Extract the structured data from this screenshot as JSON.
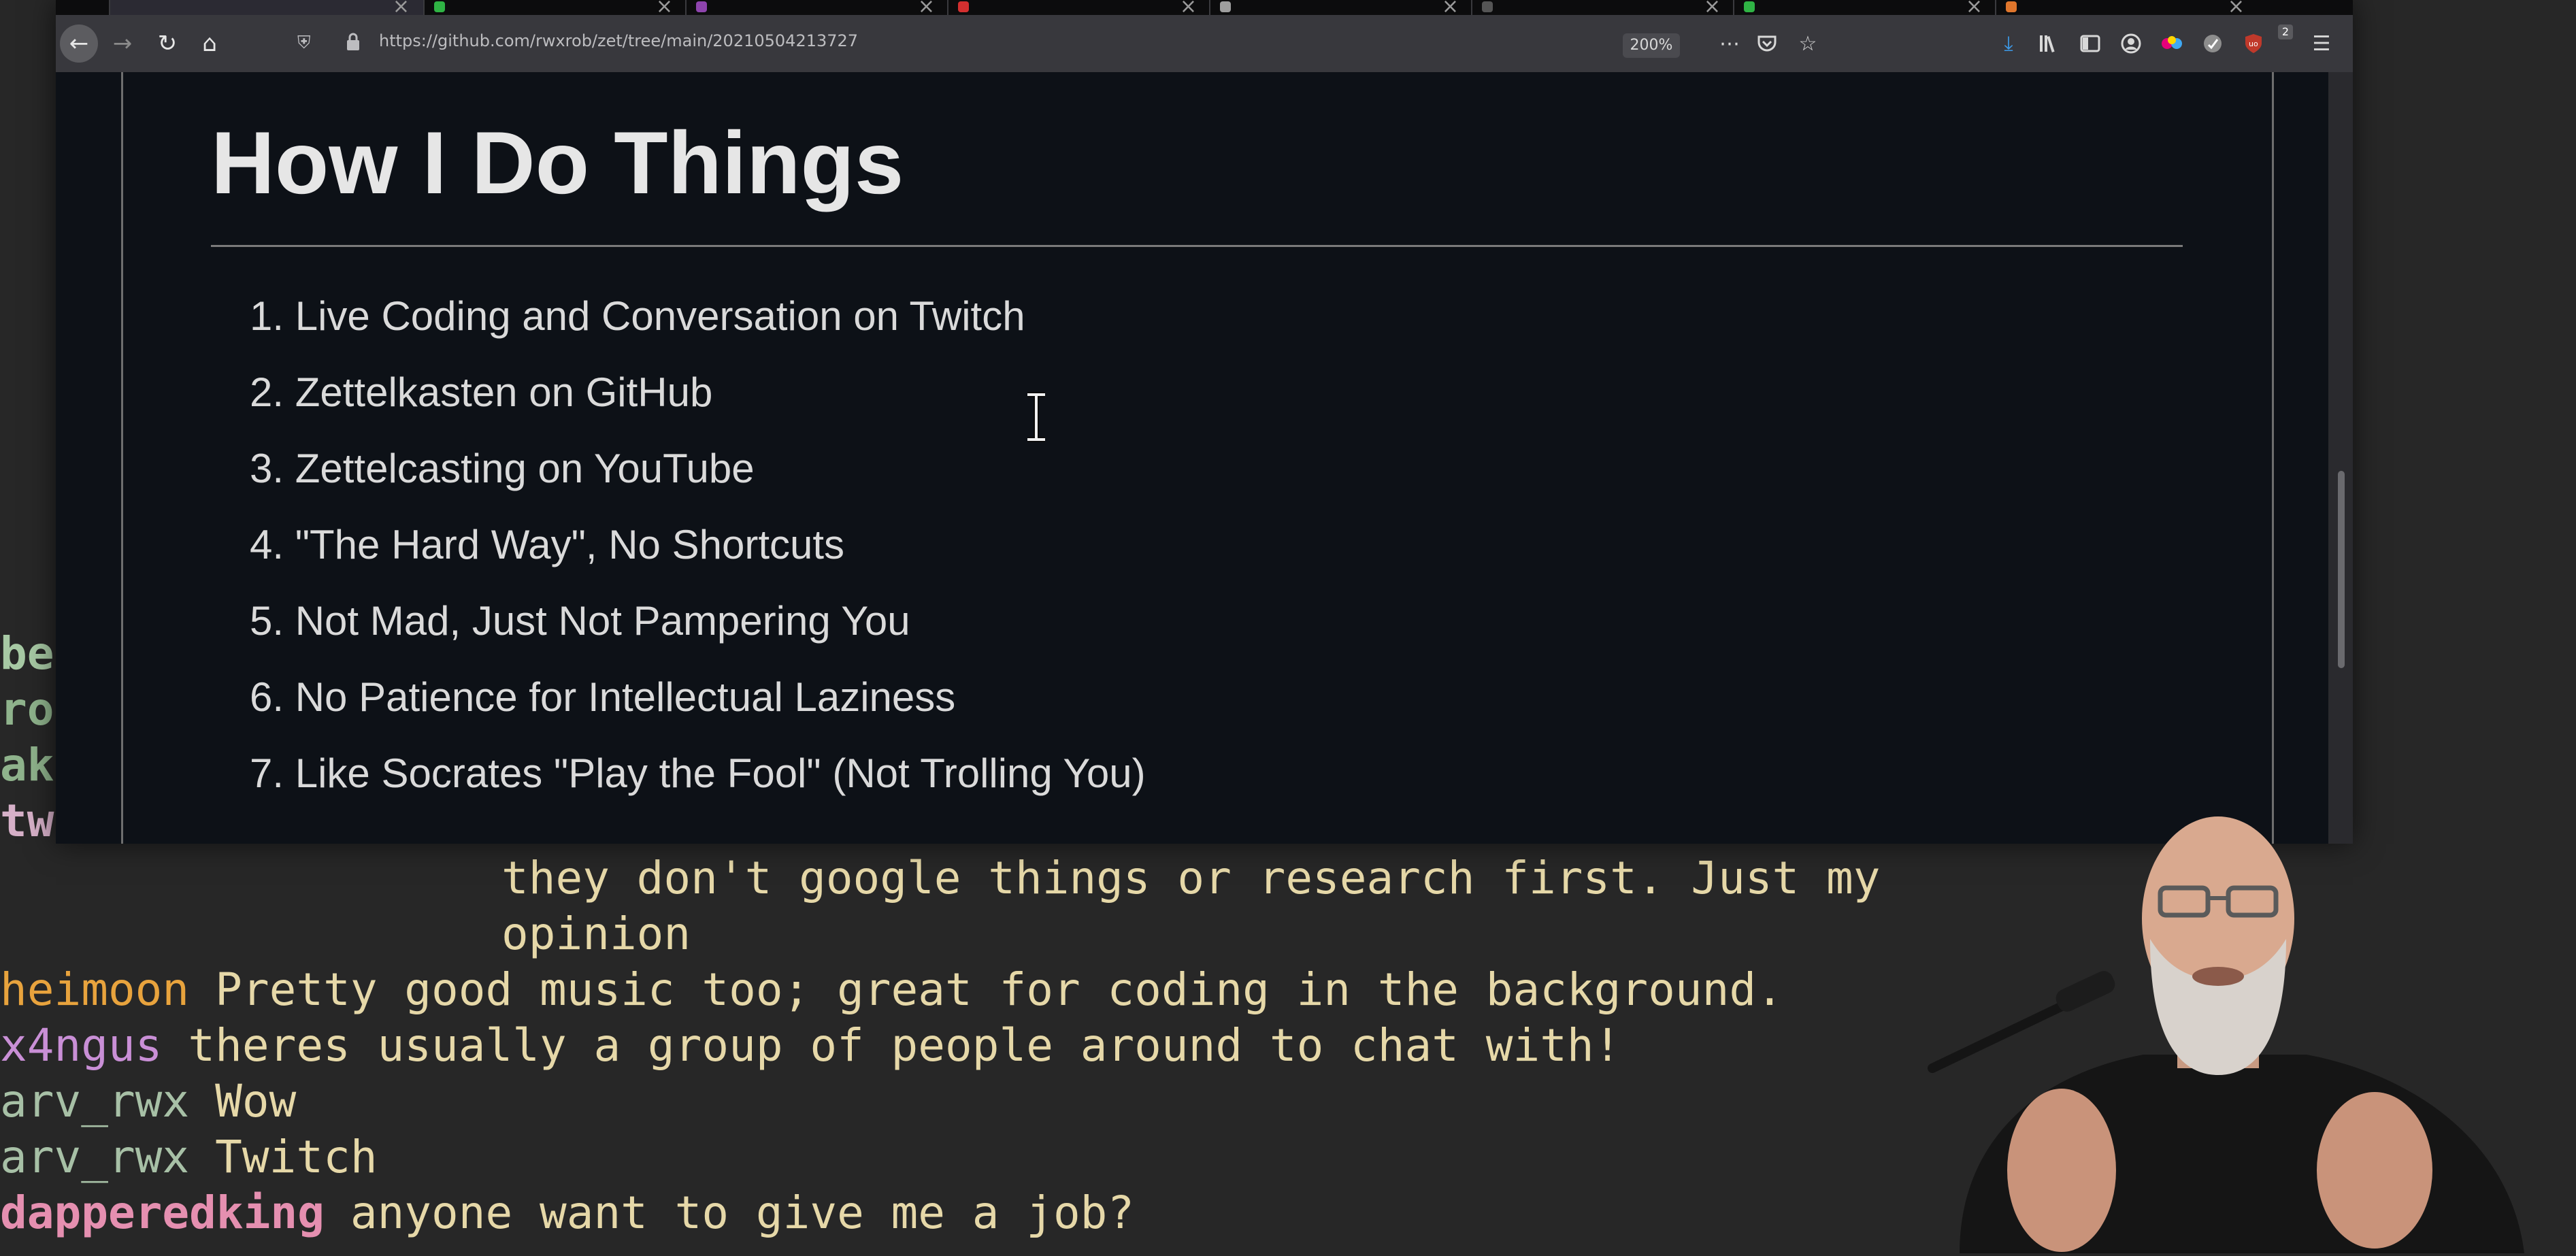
{
  "browser": {
    "url": "https://github.com/rwxrob/zet/tree/main/20210504213727",
    "zoom": "200%",
    "notification_count": "2"
  },
  "page": {
    "title": "How I Do Things",
    "items": [
      {
        "num": "1.",
        "text": "Live Coding and Conversation on Twitch"
      },
      {
        "num": "2.",
        "text": "Zettelkasten on GitHub"
      },
      {
        "num": "3.",
        "text": "Zettelcasting on YouTube"
      },
      {
        "num": "4.",
        "text": "\"The Hard Way\", No Shortcuts"
      },
      {
        "num": "5.",
        "text": "Not Mad, Just Not Pampering You"
      },
      {
        "num": "6.",
        "text": "No Patience for Intellectual Laziness"
      },
      {
        "num": "7.",
        "text": "Like Socrates \"Play the Fool\" (Not Trolling You)"
      }
    ]
  },
  "terminal": {
    "edge_fragments": [
      "bel",
      "rom",
      "ako",
      "twi"
    ],
    "continuation": [
      "they don't google things or research first. Just my",
      "opinion"
    ],
    "chat": [
      {
        "nick": "heimoon",
        "msg": "Pretty good music too; great for coding in the background.",
        "color": "#e8a33d"
      },
      {
        "nick": "x4ngus",
        "msg": "theres usually a group of people around to chat with!",
        "color": "#c98fd6"
      },
      {
        "nick": "arv_rwx",
        "msg": "Wow",
        "color": "#a7c0a6"
      },
      {
        "nick": "arv_rwx",
        "msg": "Twitch",
        "color": "#a7c0a6"
      },
      {
        "nick": "dapperedking",
        "msg": "anyone want to give me a job?",
        "color": "#e58fb0"
      }
    ]
  },
  "colors": {
    "terminal_bg": "#272727",
    "page_bg": "#0d1117",
    "toolbar_bg": "#38383d",
    "terminal_text": "#e6d8a8"
  }
}
